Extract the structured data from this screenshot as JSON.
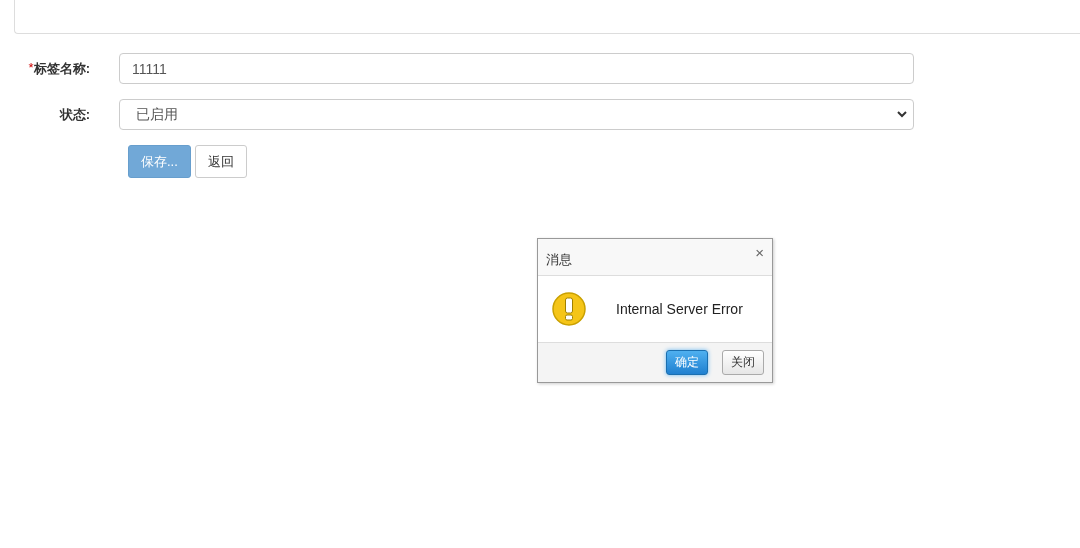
{
  "form": {
    "fields": [
      {
        "kind": "text",
        "required_mark": "*",
        "label": "标签名称:",
        "value": "11111"
      },
      {
        "kind": "select",
        "label": "状态:",
        "value": "已启用"
      }
    ],
    "buttons": [
      {
        "label": "保存...",
        "kind": "primary",
        "disabled": true
      },
      {
        "label": "返回",
        "kind": "default",
        "disabled": false
      }
    ]
  },
  "dialog": {
    "title": "消息",
    "close": "×",
    "message": "Internal Server Error",
    "buttons": [
      {
        "label": "确定",
        "kind": "primary"
      },
      {
        "label": "关闭",
        "kind": "default"
      }
    ]
  }
}
